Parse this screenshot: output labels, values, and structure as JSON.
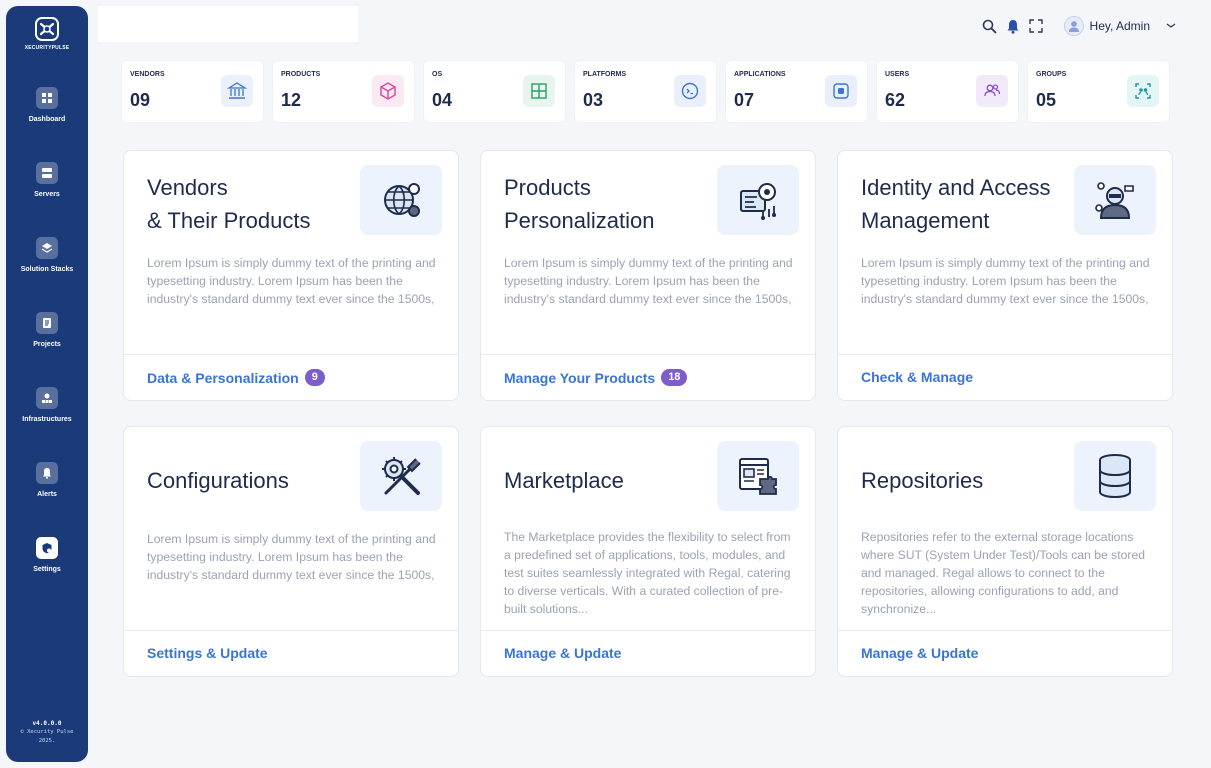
{
  "brand": {
    "name": "XECURITYPULSE"
  },
  "nav": [
    {
      "label": "Dashboard",
      "icon": "dashboard-icon"
    },
    {
      "label": "Servers",
      "icon": "server-icon"
    },
    {
      "label": "Solution Stacks",
      "icon": "stack-icon"
    },
    {
      "label": "Projects",
      "icon": "projects-icon"
    },
    {
      "label": "Infrastructures",
      "icon": "infrastructure-icon"
    },
    {
      "label": "Alerts",
      "icon": "alert-icon"
    },
    {
      "label": "Settings",
      "icon": "settings-icon",
      "active": true
    }
  ],
  "footer": {
    "version": "v4.0.0.0",
    "copyright_line1": "© Xecurity Pulse",
    "copyright_line2": "2025."
  },
  "header": {
    "greeting": "Hey, Admin"
  },
  "stats": [
    {
      "label": "VENDORS",
      "value": "09",
      "icon": "bank-icon",
      "bg": "#eaf1fb",
      "fg": "#3a74d6"
    },
    {
      "label": "PRODUCTS",
      "value": "12",
      "icon": "package-icon",
      "bg": "#fbe9f3",
      "fg": "#d6459a"
    },
    {
      "label": "OS",
      "value": "04",
      "icon": "windows-icon",
      "bg": "#e6f5ee",
      "fg": "#2f9b66"
    },
    {
      "label": "PLATFORMS",
      "value": "03",
      "icon": "platform-icon",
      "bg": "#e9f0fc",
      "fg": "#3a74d6"
    },
    {
      "label": "APPLICATIONS",
      "value": "07",
      "icon": "app-icon",
      "bg": "#e9f0fc",
      "fg": "#3a74d6"
    },
    {
      "label": "USERS",
      "value": "62",
      "icon": "users-icon",
      "bg": "#f2e9fb",
      "fg": "#8a4fc8"
    },
    {
      "label": "GROUPS",
      "value": "05",
      "icon": "groups-icon",
      "bg": "#e3f5f5",
      "fg": "#1f9a9a"
    }
  ],
  "cards": [
    {
      "title_line1": "Vendors",
      "title_line2": "& Their Products",
      "desc": "Lorem Ipsum is simply dummy text of the printing and typesetting industry. Lorem Ipsum has been the industry's standard dummy text ever since the 1500s,",
      "link": "Data & Personalization",
      "badge": "9",
      "icon": "network-globe-icon"
    },
    {
      "title_line1": "Products",
      "title_line2": "Personalization",
      "desc": "Lorem Ipsum is simply dummy text of the printing and typesetting industry. Lorem Ipsum has been the industry's standard dummy text ever since the 1500s,",
      "link": "Manage Your Products",
      "badge": "18",
      "icon": "product-settings-icon"
    },
    {
      "title_line1": "Identity and Access",
      "title_line2": "Management",
      "desc": "Lorem Ipsum is simply dummy text of the printing and typesetting industry. Lorem Ipsum has been the industry's standard dummy text ever since the 1500s,",
      "link": "Check & Manage",
      "icon": "identity-user-icon"
    },
    {
      "title_line1": "Configurations",
      "desc": "Lorem Ipsum is simply dummy text of the printing and typesetting industry. Lorem Ipsum has been the industry's standard dummy text ever since the 1500s,",
      "link": "Settings & Update",
      "icon": "tools-icon"
    },
    {
      "title_line1": "Marketplace",
      "desc": "The Marketplace provides the flexibility to select from a predefined set of applications, tools, modules, and test suites seamlessly integrated with Regal, catering to diverse verticals. With a curated collection of pre-built solutions...",
      "link": "Manage & Update",
      "icon": "marketplace-icon"
    },
    {
      "title_line1": "Repositories",
      "desc": "Repositories refer to the external storage locations where SUT (System Under Test)/Tools can be stored and managed. Regal allows to connect to the repositories, allowing configurations to add, and synchronize...",
      "link": "Manage & Update",
      "icon": "database-icon"
    }
  ]
}
